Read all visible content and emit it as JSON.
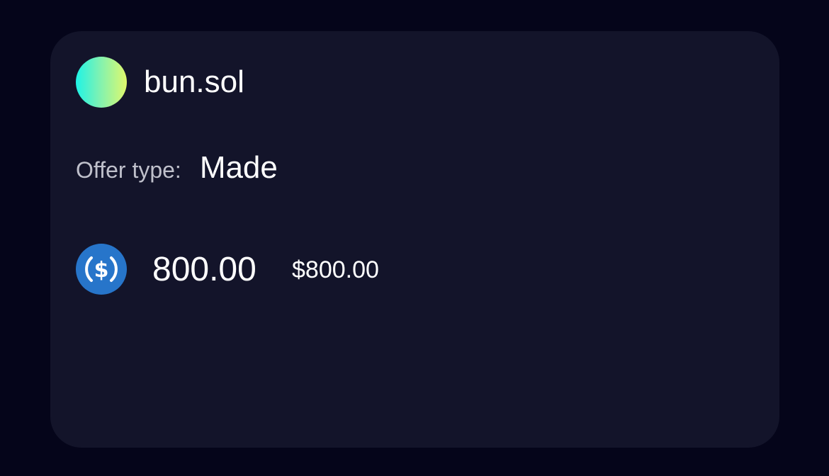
{
  "profile": {
    "name": "bun.sol",
    "avatar_gradient": [
      "#1ef3e6",
      "#7cf2b4",
      "#e0f86c"
    ]
  },
  "offer": {
    "type_label": "Offer type:",
    "type_value": "Made"
  },
  "price": {
    "token_icon": "usdc-icon",
    "amount": "800.00",
    "fiat": "$800.00",
    "token_color": "#2775ca"
  },
  "colors": {
    "background": "#05051a",
    "card": "#13142a",
    "label": "#bfc0cb"
  }
}
